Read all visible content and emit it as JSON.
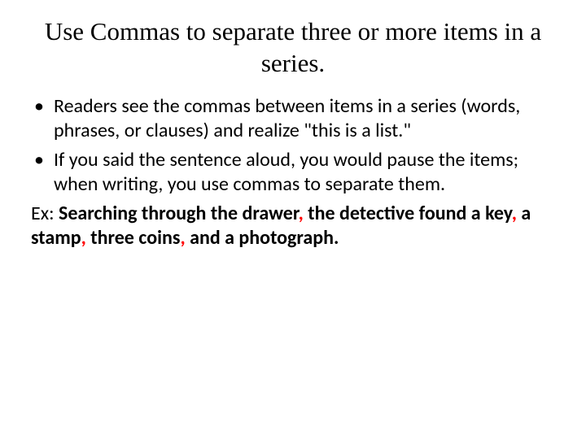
{
  "title": "Use Commas to separate three or more items in a series.",
  "bullets": [
    "Readers see the commas between items in a series (words, phrases, or clauses) and realize \"this is a list.\"",
    "If you said the sentence aloud, you would pause the items; when writing, you use commas to separate them."
  ],
  "example": {
    "label": "Ex:  ",
    "parts": [
      {
        "text": "Searching through the drawer",
        "bold": true
      },
      {
        "text": ",",
        "red": true
      },
      {
        "text": " the detective found a key",
        "bold": true
      },
      {
        "text": ",",
        "red": true
      },
      {
        "text": " a stamp",
        "bold": true
      },
      {
        "text": ",",
        "red": true
      },
      {
        "text": " three coins",
        "bold": true
      },
      {
        "text": ",",
        "red": true
      },
      {
        "text": " and a photograph.",
        "bold": true
      }
    ]
  }
}
